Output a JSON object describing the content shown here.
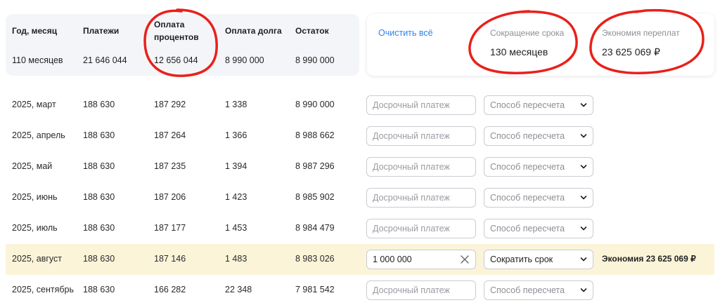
{
  "summary": {
    "headers": {
      "year_month": "Год, месяц",
      "payments": "Платежи",
      "interest_l1": "Оплата",
      "interest_l2": "процентов",
      "debt": "Оплата долга",
      "remaining": "Остаток"
    },
    "totals": {
      "period": "110 месяцев",
      "payments": "21 646 044",
      "interest": "12 656 044",
      "debt": "8 990 000",
      "remaining": "8 990 000"
    }
  },
  "card": {
    "clear_all": "Очистить всё",
    "term_reduction_label": "Сокращение срока",
    "term_reduction_value": "130 месяцев",
    "savings_label": "Экономия переплат",
    "savings_value": "23 625 069 ₽"
  },
  "form": {
    "prepayment_placeholder": "Досрочный платеж",
    "method_placeholder": "Способ пересчета"
  },
  "rows": [
    {
      "month": "2025, март",
      "payment": "188 630",
      "interest": "187 292",
      "debt": "1 338",
      "remaining": "8 990 000"
    },
    {
      "month": "2025, апрель",
      "payment": "188 630",
      "interest": "187 264",
      "debt": "1 366",
      "remaining": "8 988 662"
    },
    {
      "month": "2025, май",
      "payment": "188 630",
      "interest": "187 235",
      "debt": "1 394",
      "remaining": "8 987 296"
    },
    {
      "month": "2025, июнь",
      "payment": "188 630",
      "interest": "187 206",
      "debt": "1 423",
      "remaining": "8 985 902"
    },
    {
      "month": "2025, июль",
      "payment": "188 630",
      "interest": "187 177",
      "debt": "1 453",
      "remaining": "8 984 479"
    },
    {
      "month": "2025, август",
      "payment": "188 630",
      "interest": "187 146",
      "debt": "1 483",
      "remaining": "8 983 026",
      "prepayment": "1 000 000",
      "method": "Сократить срок",
      "savings": "Экономия 23 625 069 ₽"
    },
    {
      "month": "2025, сентябрь",
      "payment": "188 630",
      "interest": "166 282",
      "debt": "22 348",
      "remaining": "7 981 542"
    }
  ],
  "colors": {
    "accent_link": "#2f80ed",
    "highlight_row": "#fbf4d9",
    "annotation_red": "#e8211b"
  },
  "icons": {
    "dropdown": "chevron-down-icon",
    "clear_field": "close-icon"
  }
}
